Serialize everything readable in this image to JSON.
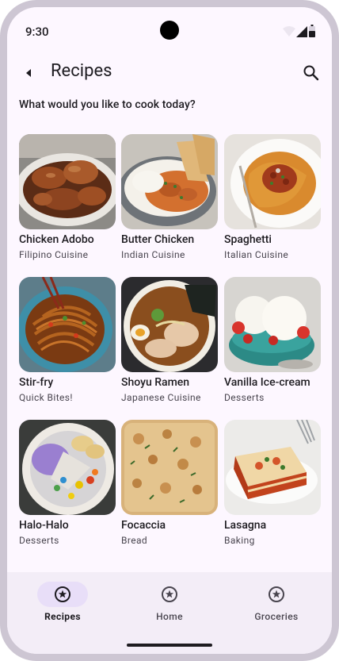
{
  "status_bar": {
    "time": "9:30"
  },
  "app_bar": {
    "title": "Recipes"
  },
  "subtitle": "What would you like to cook today?",
  "recipes": [
    {
      "name": "Chicken Adobo",
      "cuisine": "Filipino Cuisine"
    },
    {
      "name": "Butter Chicken",
      "cuisine": "Indian Cuisine"
    },
    {
      "name": "Spaghetti",
      "cuisine": "Italian Cuisine"
    },
    {
      "name": "Stir-fry",
      "cuisine": "Quick Bites!"
    },
    {
      "name": "Shoyu Ramen",
      "cuisine": "Japanese Cuisine"
    },
    {
      "name": "Vanilla Ice-cream",
      "cuisine": "Desserts"
    },
    {
      "name": "Halo-Halo",
      "cuisine": "Desserts"
    },
    {
      "name": "Focaccia",
      "cuisine": "Bread"
    },
    {
      "name": "Lasagna",
      "cuisine": "Baking"
    }
  ],
  "nav": [
    {
      "label": "Recipes",
      "icon": "star-circle-icon",
      "active": true
    },
    {
      "label": "Home",
      "icon": "star-circle-icon",
      "active": false
    },
    {
      "label": "Groceries",
      "icon": "star-circle-icon",
      "active": false
    }
  ],
  "colors": {
    "background": "#fdf7ff",
    "nav_background": "#f3edf7",
    "active_indicator": "#e8def8",
    "on_surface": "#1d1b20",
    "on_surface_variant": "#49454f"
  }
}
